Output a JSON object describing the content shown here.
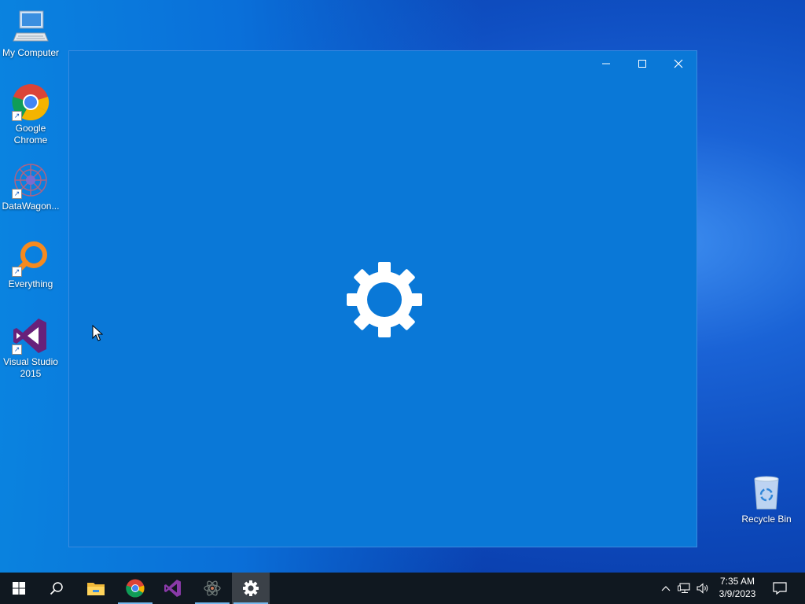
{
  "desktop": {
    "icons": [
      {
        "label": "My Computer",
        "icon": "computer-icon"
      },
      {
        "label": "Google Chrome",
        "icon": "chrome-icon"
      },
      {
        "label": "DataWagon...",
        "icon": "datawagon-icon"
      },
      {
        "label": "Everything",
        "icon": "everything-icon"
      },
      {
        "label": "Visual Studio 2015",
        "icon": "visual-studio-icon"
      },
      {
        "label": "Recycle Bin",
        "icon": "recycle-bin-icon"
      }
    ]
  },
  "window": {
    "controls": [
      "minimize-icon",
      "maximize-icon",
      "close-icon"
    ],
    "splash_icon": "gear-icon",
    "background": "#0a78d7"
  },
  "taskbar": {
    "items": [
      "windows-start-icon",
      "search-icon",
      "file-explorer-icon",
      "chrome-icon",
      "visual-studio-icon",
      "atom-icon",
      "settings-icon"
    ],
    "active_item": "settings-icon",
    "clock": {
      "time": "7:35 AM",
      "date": "3/9/2023"
    },
    "tray_icons": [
      "chevron-up-icon",
      "network-icon",
      "volume-icon",
      "notification-icon"
    ]
  }
}
